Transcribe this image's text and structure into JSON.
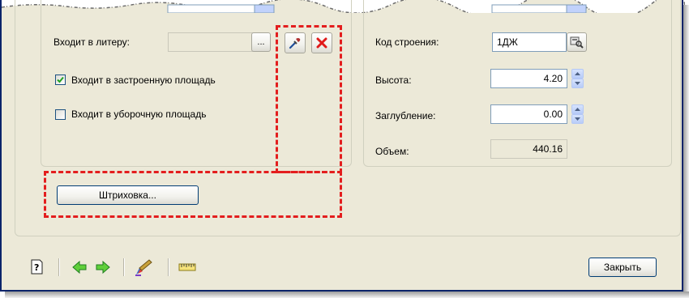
{
  "left_panel": {
    "litera_label": "Входит в литеру:",
    "litera_value": "",
    "browse_label": "...",
    "built_area_label": "Входит в застроенную площадь",
    "built_area_checked": true,
    "cleaning_area_label": "Входит в уборочную площадь",
    "cleaning_area_checked": false,
    "hatching_button": "Штриховка..."
  },
  "right_panel": {
    "building_code_label": "Код строения:",
    "building_code_value": "1ДЖ",
    "height_label": "Высота:",
    "height_value": "4.20",
    "depth_label": "Заглубление:",
    "depth_value": "0.00",
    "volume_label": "Объем:",
    "volume_value": "440.16"
  },
  "footer": {
    "close_button": "Закрыть"
  },
  "icons": {
    "help": "help-icon",
    "back": "back-arrow-icon",
    "forward": "forward-arrow-icon",
    "paint": "paint-brush-icon",
    "ruler": "ruler-icon",
    "pipette": "pipette-icon",
    "delete": "delete-x-icon",
    "lookup": "lookup-icon"
  },
  "colors": {
    "dialog_bg": "#ece9d8",
    "frame_blue": "#0a246a",
    "highlight_red": "#e31e1e",
    "arrow_green": "#3cb93c"
  }
}
